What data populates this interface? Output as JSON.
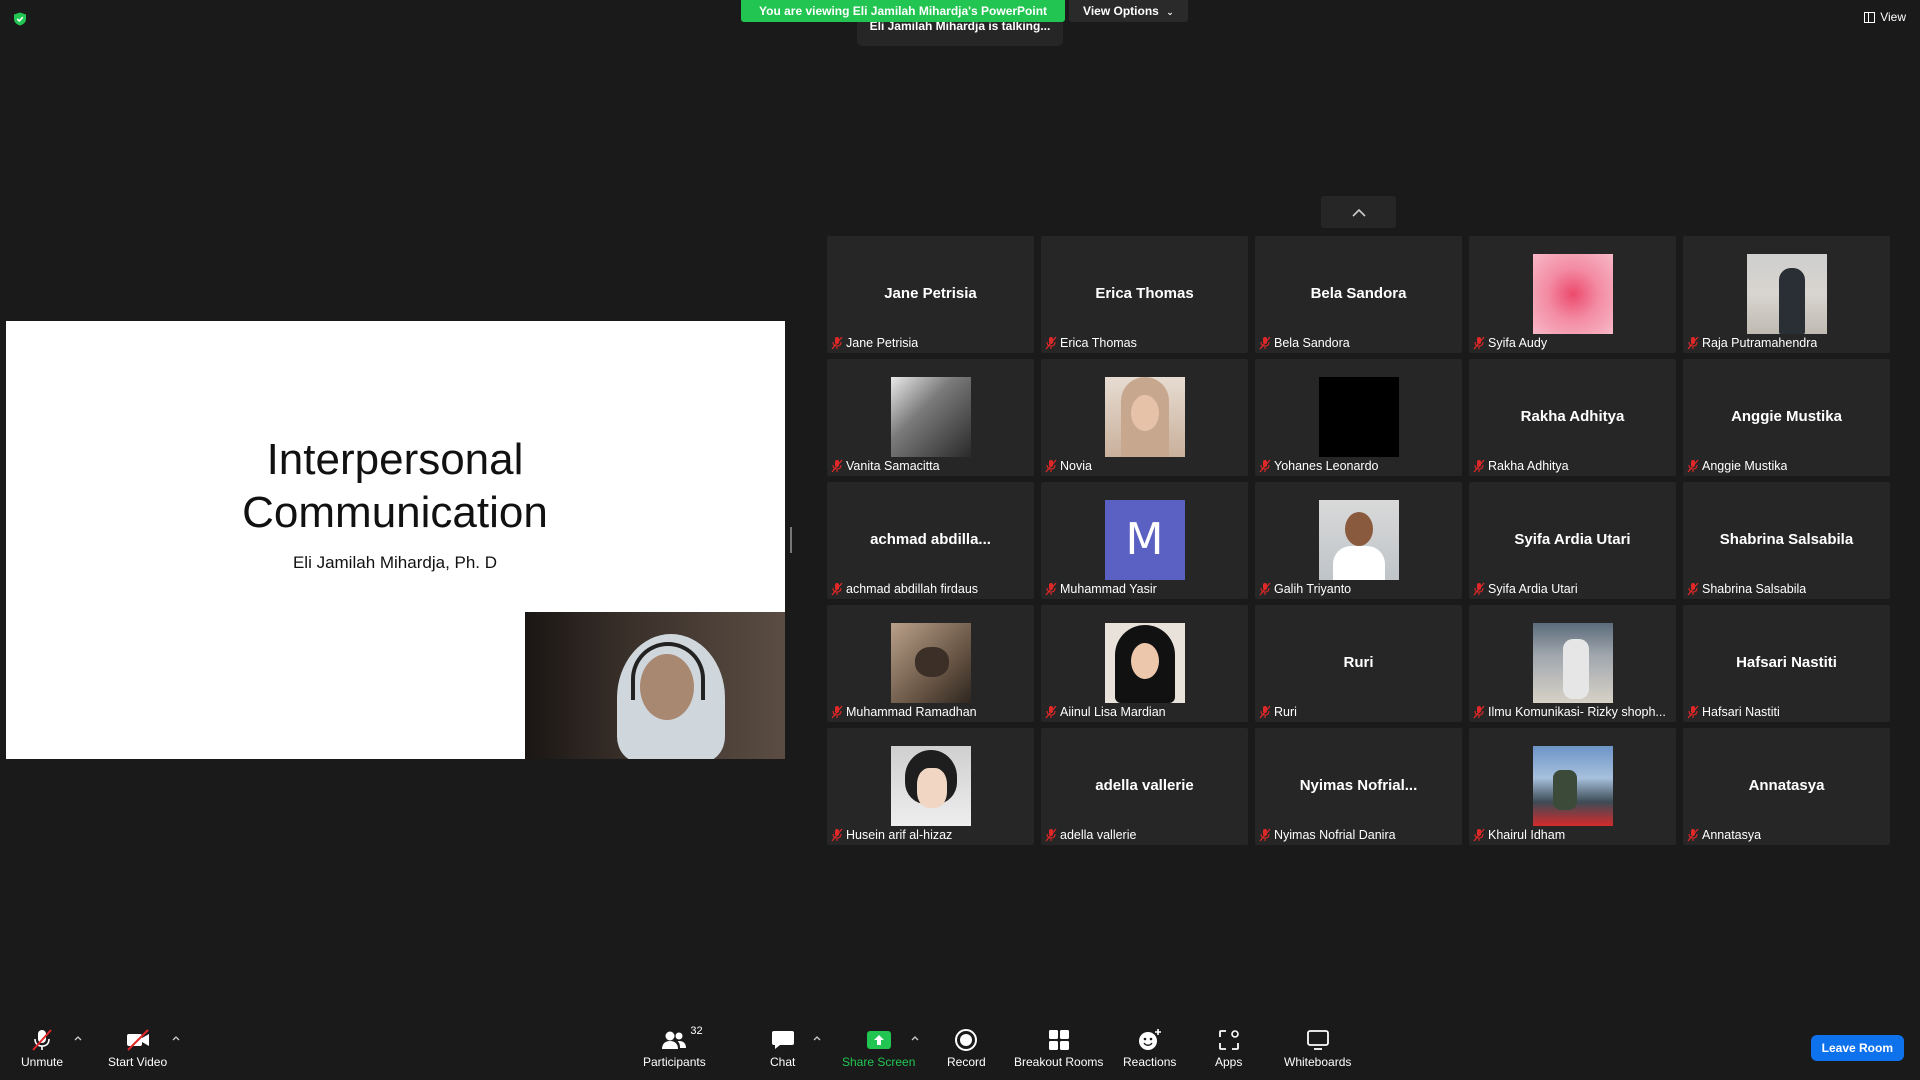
{
  "top": {
    "banner": "You are viewing Eli Jamilah Mihardja's PowerPoint",
    "view_options": "View Options",
    "talking": "Eli Jamilah Mihardja is talking...",
    "view": "View"
  },
  "slide": {
    "title_line1": "Interpersonal",
    "title_line2": "Communication",
    "subtitle": "Eli Jamilah Mihardja, Ph. D"
  },
  "participants": [
    {
      "name": "Jane Petrisia",
      "display": "Jane Petrisia",
      "avatar": ""
    },
    {
      "name": "Erica Thomas",
      "display": "Erica Thomas",
      "avatar": ""
    },
    {
      "name": "Bela Sandora",
      "display": "Bela Sandora",
      "avatar": ""
    },
    {
      "name": "Syifa Audy",
      "display": "",
      "avatar": "pink"
    },
    {
      "name": "Raja Putramahendra",
      "display": "",
      "avatar": "room"
    },
    {
      "name": "Vanita Samacitta",
      "display": "",
      "avatar": "bw"
    },
    {
      "name": "Novia",
      "display": "",
      "avatar": "girl"
    },
    {
      "name": "Yohanes Leonardo",
      "display": "",
      "avatar": "black"
    },
    {
      "name": "Rakha Adhitya",
      "display": "Rakha Adhitya",
      "avatar": ""
    },
    {
      "name": "Anggie Mustika",
      "display": "Anggie Mustika",
      "avatar": ""
    },
    {
      "name": "achmad abdillah firdaus",
      "display": "achmad  abdilla...",
      "avatar": ""
    },
    {
      "name": "Muhammad Yasir",
      "display": "M",
      "avatar": "m"
    },
    {
      "name": "Galih Triyanto",
      "display": "",
      "avatar": "man"
    },
    {
      "name": "Syifa Ardia Utari",
      "display": "Syifa Ardia Utari",
      "avatar": ""
    },
    {
      "name": "Shabrina Salsabila",
      "display": "Shabrina Salsabila",
      "avatar": ""
    },
    {
      "name": "Muhammad Ramadhan",
      "display": "",
      "avatar": "cat"
    },
    {
      "name": "Aiinul Lisa Mardian",
      "display": "",
      "avatar": "hijab2"
    },
    {
      "name": "Ruri",
      "display": "Ruri",
      "avatar": ""
    },
    {
      "name": "Ilmu Komunikasi- Rizky shoph...",
      "display": "",
      "avatar": "street"
    },
    {
      "name": "Hafsari Nastiti",
      "display": "Hafsari Nastiti",
      "avatar": ""
    },
    {
      "name": "Husein arif al-hizaz",
      "display": "",
      "avatar": "anime"
    },
    {
      "name": "adella vallerie",
      "display": "adella vallerie",
      "avatar": ""
    },
    {
      "name": "Nyimas Nofrial Danira",
      "display": "Nyimas  Nofrial...",
      "avatar": ""
    },
    {
      "name": "Khairul Idham",
      "display": "",
      "avatar": "coast"
    },
    {
      "name": "Annatasya",
      "display": "Annatasya",
      "avatar": ""
    }
  ],
  "toolbar": {
    "unmute": "Unmute",
    "start_video": "Start Video",
    "participants": "Participants",
    "participants_count": "32",
    "chat": "Chat",
    "share_screen": "Share Screen",
    "record": "Record",
    "breakout_rooms": "Breakout Rooms",
    "reactions": "Reactions",
    "apps": "Apps",
    "whiteboards": "Whiteboards",
    "leave": "Leave Room"
  },
  "colors": {
    "accent_green": "#23c552",
    "leave_blue": "#0e72ed",
    "muted_red": "#e02828",
    "background": "#1a1a1a",
    "tile": "#262626"
  }
}
